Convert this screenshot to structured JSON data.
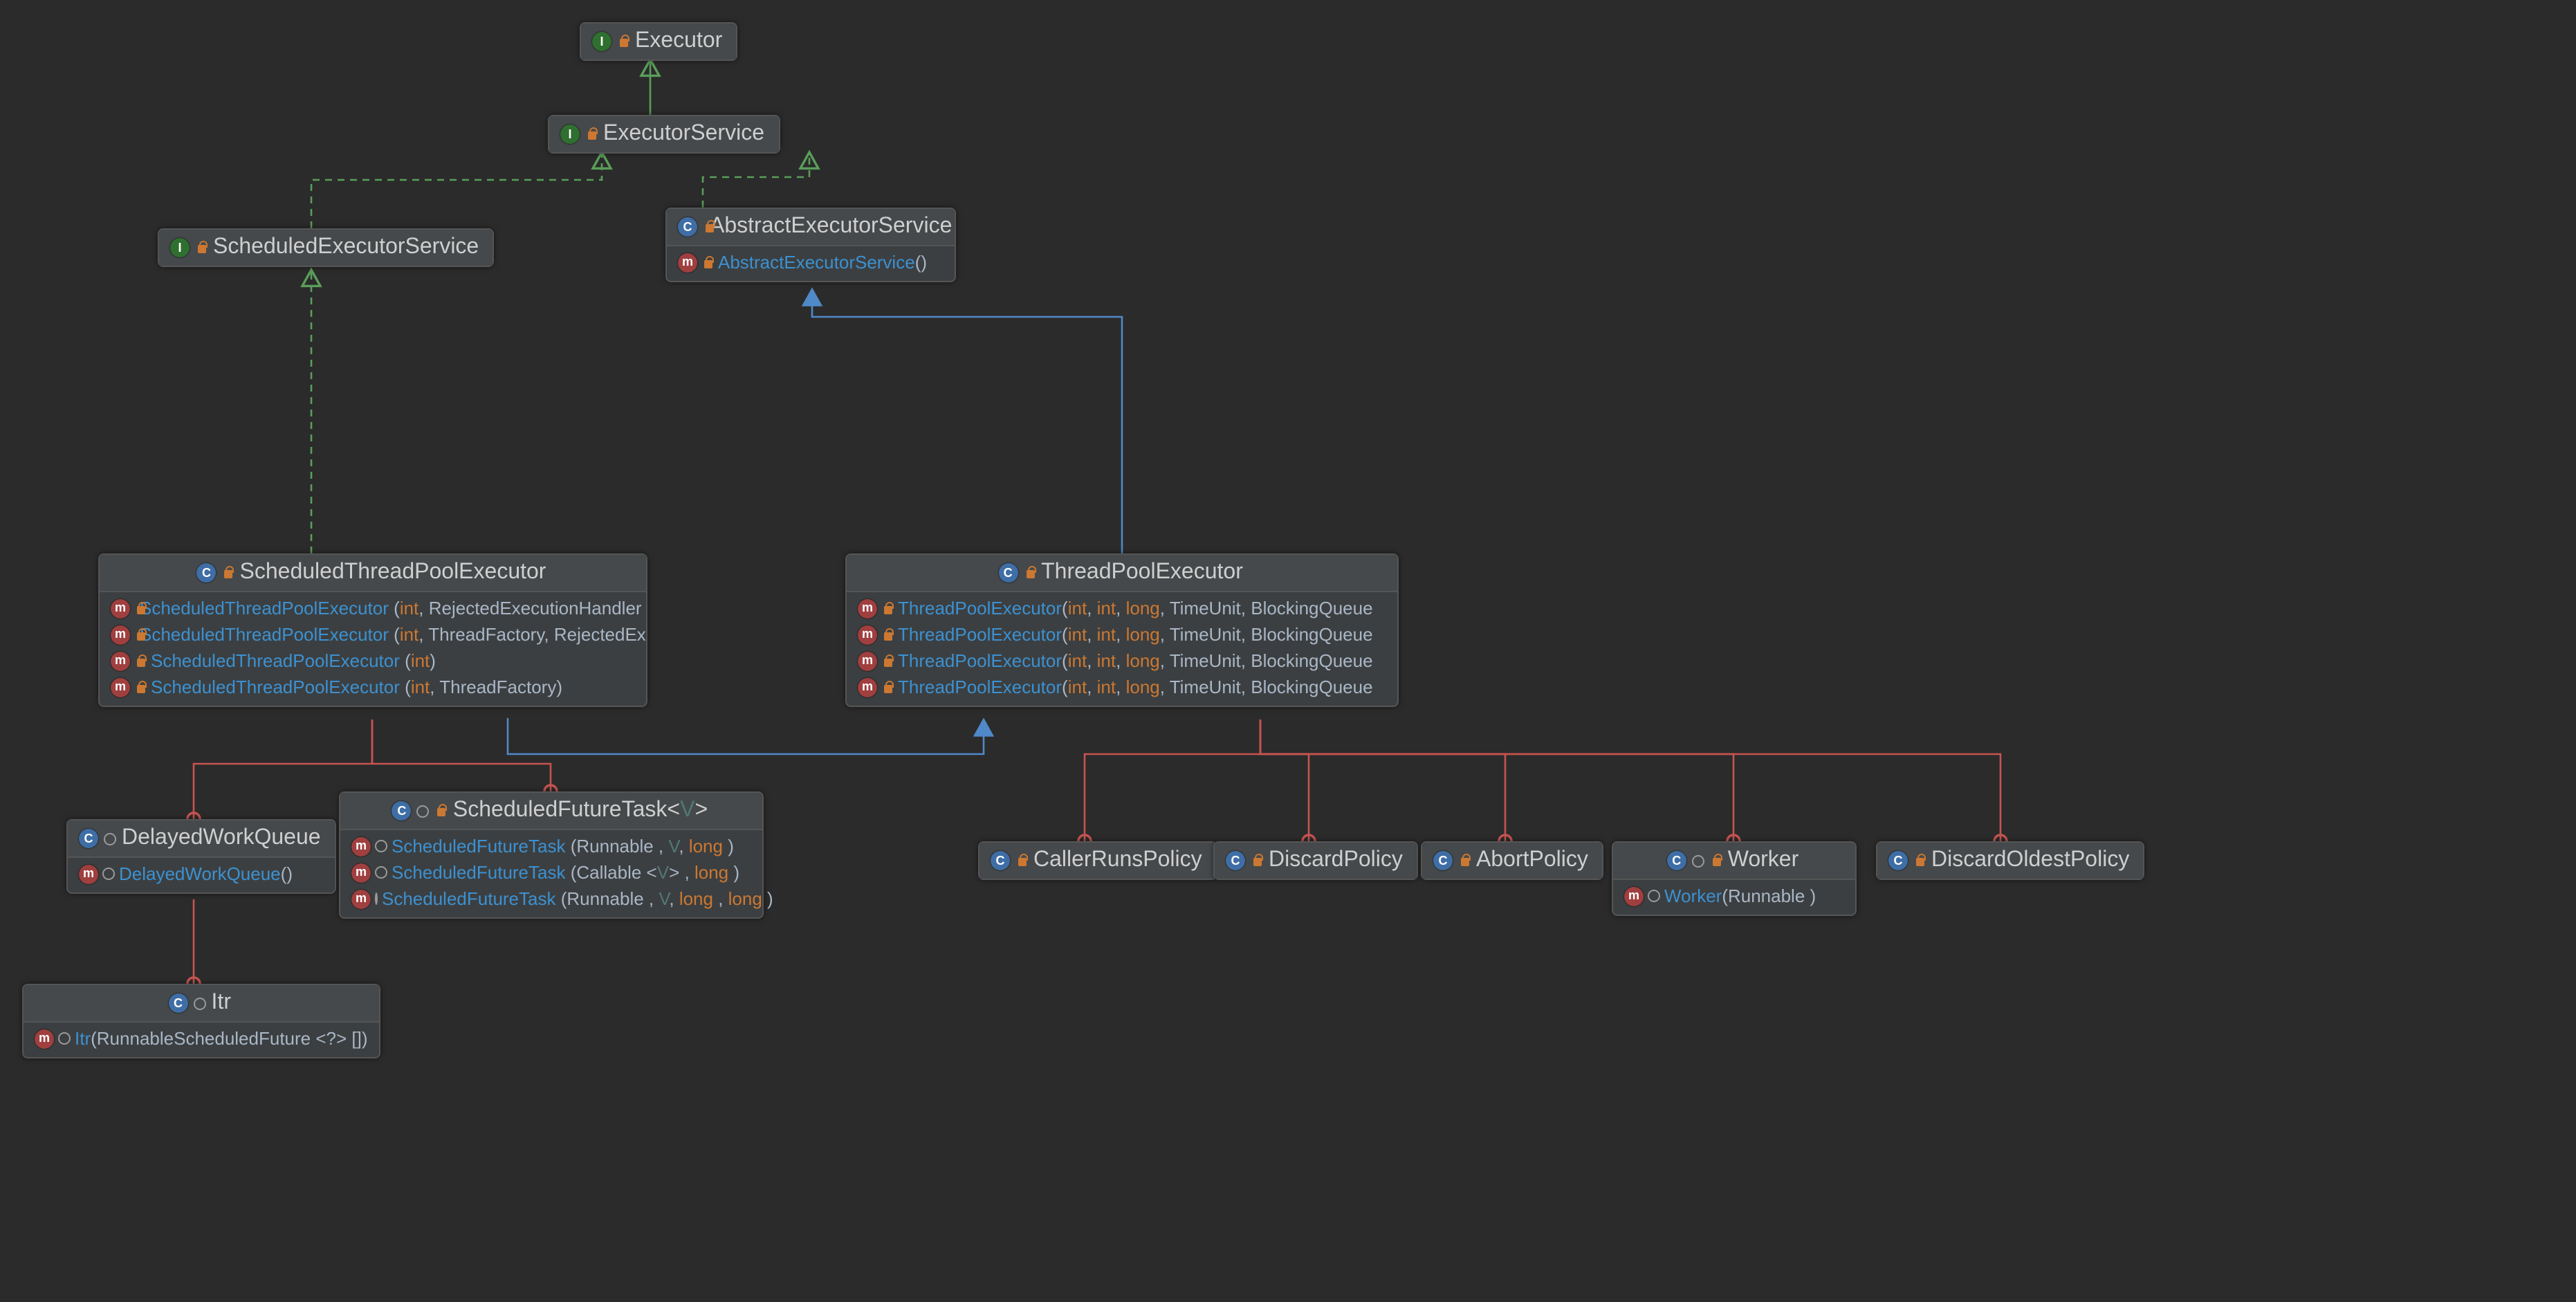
{
  "nodes": {
    "executor": {
      "name": "Executor",
      "kind": "interface"
    },
    "executorservice": {
      "name": "ExecutorService",
      "kind": "interface"
    },
    "scheduledexecutorservice": {
      "name": "ScheduledExecutorService",
      "kind": "interface"
    },
    "abstractexecutorservice": {
      "name": "AbstractExecutorService",
      "kind": "class",
      "members": [
        {
          "name": "AbstractExecutorService",
          "sig_leading": "",
          "sig_trailing": "()"
        }
      ]
    },
    "scheduledthreadpoolexecutor": {
      "name": "ScheduledThreadPoolExecutor",
      "kind": "class",
      "members": [
        {
          "name": "ScheduledThreadPoolExecutor",
          "sig_html": " (<kw>int</kw>, RejectedExecutionHandler )"
        },
        {
          "name": "ScheduledThreadPoolExecutor",
          "sig_html": " (<kw>int</kw>, ThreadFactory, RejectedExecu"
        },
        {
          "name": "ScheduledThreadPoolExecutor",
          "sig_html": " (<kw>int</kw>)"
        },
        {
          "name": "ScheduledThreadPoolExecutor",
          "sig_html": " (<kw>int</kw>, ThreadFactory)"
        }
      ]
    },
    "threadpoolexecutor": {
      "name": "ThreadPoolExecutor",
      "kind": "class",
      "members": [
        {
          "name": "ThreadPoolExecutor",
          "sig_html": "(<kw>int</kw>, <kw>int</kw>, <kw>long</kw>, TimeUnit, BlockingQueue <Run"
        },
        {
          "name": "ThreadPoolExecutor",
          "sig_html": "(<kw>int</kw>, <kw>int</kw>, <kw>long</kw>, TimeUnit, BlockingQueue <Run"
        },
        {
          "name": "ThreadPoolExecutor",
          "sig_html": "(<kw>int</kw>, <kw>int</kw>, <kw>long</kw>, TimeUnit, BlockingQueue <Run"
        },
        {
          "name": "ThreadPoolExecutor",
          "sig_html": "(<kw>int</kw>, <kw>int</kw>, <kw>long</kw>, TimeUnit, BlockingQueue <Run"
        }
      ]
    },
    "delayedworkqueue": {
      "name": "DelayedWorkQueue",
      "kind": "class",
      "inner": true,
      "members": [
        {
          "name": "DelayedWorkQueue",
          "sig_html": "()"
        }
      ]
    },
    "scheduledfuturetask": {
      "name_html": "ScheduledFutureTask&lt;<g>V</g>&gt;",
      "kind": "class",
      "inner": true,
      "members": [
        {
          "name": "ScheduledFutureTask",
          "sig_html": " (Runnable , <g>V</g>, <kw>long</kw> )"
        },
        {
          "name": "ScheduledFutureTask",
          "sig_html": " (Callable &lt;<g>V</g>&gt; , <kw>long</kw> )"
        },
        {
          "name": "ScheduledFutureTask",
          "sig_html": " (Runnable , <g>V</g>, <kw>long</kw> , <kw>long</kw> )"
        }
      ]
    },
    "itr": {
      "name": "Itr",
      "kind": "class",
      "inner": true,
      "members": [
        {
          "name": "Itr",
          "sig_html": "(RunnableScheduledFuture &lt;?&gt; [])"
        }
      ]
    },
    "callerrunspolicy": {
      "name": "CallerRunsPolicy",
      "kind": "class"
    },
    "discardpolicy": {
      "name": "DiscardPolicy",
      "kind": "class"
    },
    "abortpolicy": {
      "name": "AbortPolicy",
      "kind": "class"
    },
    "worker": {
      "name": "Worker",
      "kind": "class",
      "inner": true,
      "members": [
        {
          "name": "Worker",
          "sig_html": "(Runnable )"
        }
      ]
    },
    "discardoldestpolicy": {
      "name": "DiscardOldestPolicy",
      "kind": "class"
    }
  },
  "edges": [
    {
      "from": "executorservice",
      "to": "executor",
      "style": "impl"
    },
    {
      "from": "scheduledexecutorservice",
      "to": "executorservice",
      "style": "impl"
    },
    {
      "from": "abstractexecutorservice",
      "to": "executorservice",
      "style": "impl"
    },
    {
      "from": "scheduledthreadpoolexecutor",
      "to": "scheduledexecutorservice",
      "style": "impl"
    },
    {
      "from": "threadpoolexecutor",
      "to": "abstractexecutorservice",
      "style": "extends"
    },
    {
      "from": "scheduledthreadpoolexecutor",
      "to": "threadpoolexecutor",
      "style": "extends"
    },
    {
      "from": "delayedworkqueue",
      "to": "scheduledthreadpoolexecutor",
      "style": "inner"
    },
    {
      "from": "scheduledfuturetask",
      "to": "scheduledthreadpoolexecutor",
      "style": "inner"
    },
    {
      "from": "itr",
      "to": "delayedworkqueue",
      "style": "inner"
    },
    {
      "from": "callerrunspolicy",
      "to": "threadpoolexecutor",
      "style": "inner"
    },
    {
      "from": "discardpolicy",
      "to": "threadpoolexecutor",
      "style": "inner"
    },
    {
      "from": "abortpolicy",
      "to": "threadpoolexecutor",
      "style": "inner"
    },
    {
      "from": "worker",
      "to": "threadpoolexecutor",
      "style": "inner"
    },
    {
      "from": "discardoldestpolicy",
      "to": "threadpoolexecutor",
      "style": "inner"
    }
  ],
  "glyphs": {
    "interface": "I",
    "class": "C",
    "method": "m"
  }
}
